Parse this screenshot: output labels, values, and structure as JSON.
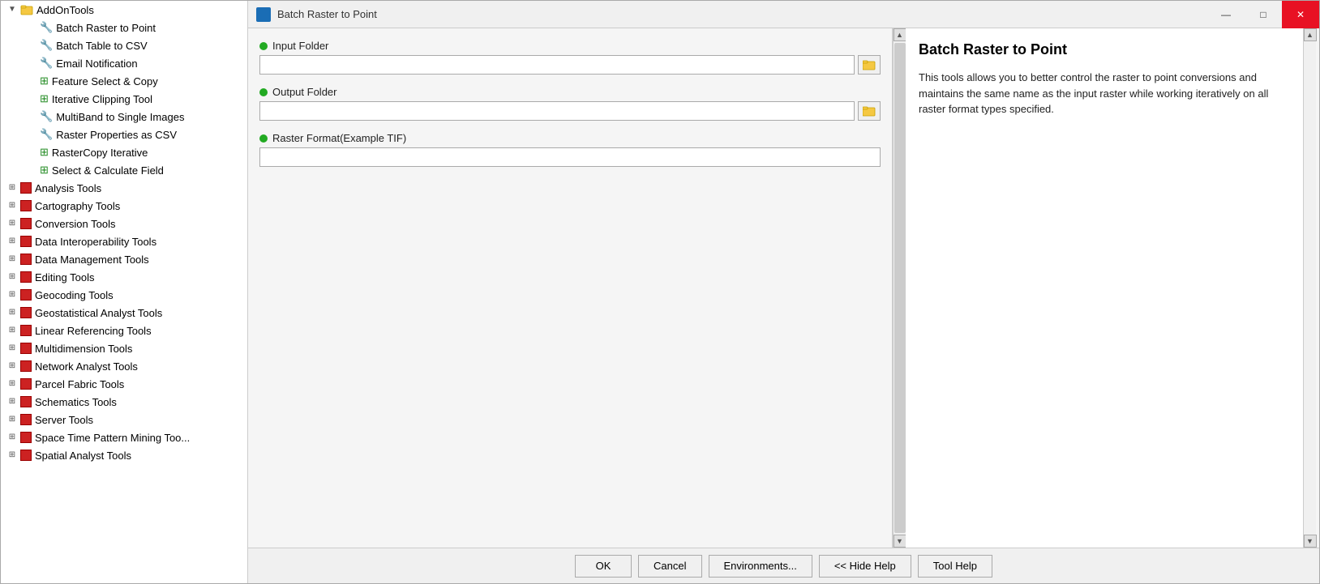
{
  "window": {
    "title": "Batch Raster to Point",
    "controls": {
      "minimize": "—",
      "maximize": "□",
      "close": "✕"
    }
  },
  "sidebar": {
    "addon_label": "AddOnTools",
    "items": [
      {
        "label": "Batch Raster to Point",
        "icon": "blue-tool"
      },
      {
        "label": "Batch Table to CSV",
        "icon": "blue-tool"
      },
      {
        "label": "Email Notification",
        "icon": "blue-tool"
      },
      {
        "label": "Feature Select & Copy",
        "icon": "green-plus"
      },
      {
        "label": "Iterative Clipping Tool",
        "icon": "green-plus"
      },
      {
        "label": "MultiBand to Single Images",
        "icon": "blue-tool"
      },
      {
        "label": "Raster Properties as CSV",
        "icon": "blue-tool"
      },
      {
        "label": "RasterCopy Iterative",
        "icon": "green-plus"
      },
      {
        "label": "Select & Calculate Field",
        "icon": "green-plus"
      }
    ],
    "toolboxes": [
      {
        "label": "Analysis Tools"
      },
      {
        "label": "Cartography Tools"
      },
      {
        "label": "Conversion Tools"
      },
      {
        "label": "Data Interoperability Tools"
      },
      {
        "label": "Data Management Tools"
      },
      {
        "label": "Editing Tools"
      },
      {
        "label": "Geocoding Tools"
      },
      {
        "label": "Geostatistical Analyst Tools"
      },
      {
        "label": "Linear Referencing Tools"
      },
      {
        "label": "Multidimension Tools"
      },
      {
        "label": "Network Analyst Tools"
      },
      {
        "label": "Parcel Fabric Tools"
      },
      {
        "label": "Schematics Tools"
      },
      {
        "label": "Server Tools"
      },
      {
        "label": "Space Time Pattern Mining Too..."
      },
      {
        "label": "Spatial Analyst Tools"
      }
    ]
  },
  "form": {
    "fields": [
      {
        "id": "input-folder",
        "label": "Input Folder",
        "required": true,
        "value": "",
        "placeholder": "",
        "has_browse": true
      },
      {
        "id": "output-folder",
        "label": "Output Folder",
        "required": true,
        "value": "",
        "placeholder": "",
        "has_browse": true
      },
      {
        "id": "raster-format",
        "label": "Raster Format(Example TIF)",
        "required": true,
        "value": "",
        "placeholder": "",
        "has_browse": false
      }
    ]
  },
  "help": {
    "title": "Batch Raster to Point",
    "description": "This tools allows you to better control the raster to point conversions and maintains the same name as the input raster while working iteratively on all raster format types specified."
  },
  "buttons": [
    {
      "id": "ok",
      "label": "OK"
    },
    {
      "id": "cancel",
      "label": "Cancel"
    },
    {
      "id": "environments",
      "label": "Environments..."
    },
    {
      "id": "hide-help",
      "label": "<< Hide Help"
    },
    {
      "id": "tool-help",
      "label": "Tool Help"
    }
  ]
}
